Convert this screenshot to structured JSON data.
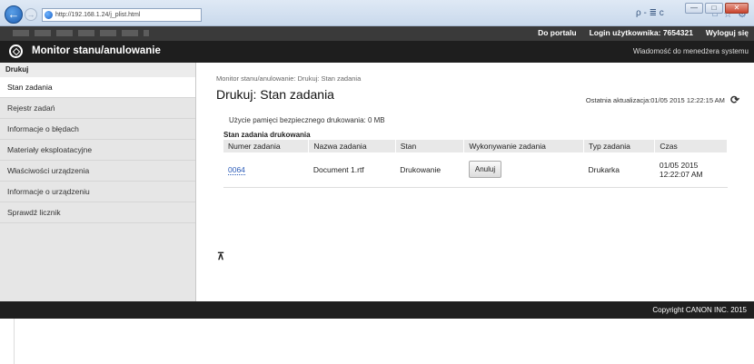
{
  "browser": {
    "url": "http://192.168.1.24/j_plist.html",
    "search_hint": "ρ - ≣ c",
    "icons": [
      "back-icon",
      "forward-icon",
      "home-icon",
      "star-icon",
      "gear-icon"
    ],
    "window_controls": [
      "—",
      "□",
      "✕"
    ]
  },
  "topbar": {
    "portal_link": "Do portalu",
    "login_label": "Login użytkownika:",
    "login_value": "7654321",
    "logout_link": "Wyloguj się"
  },
  "header": {
    "title": "Monitor stanu/anulowanie",
    "message_link": "Wiadomość do menedżera systemu"
  },
  "sidebar": {
    "heading": "Drukuj",
    "items": [
      {
        "label": "Stan zadania"
      },
      {
        "label": "Rejestr zadań"
      },
      {
        "label": "Informacje o błędach"
      },
      {
        "label": "Materiały eksploatacyjne"
      },
      {
        "label": "Właściwości urządzenia"
      },
      {
        "label": "Informacje o urządzeniu"
      },
      {
        "label": "Sprawdź licznik"
      }
    ]
  },
  "main": {
    "breadcrumb": "Monitor stanu/anulowanie: Drukuj: Stan zadania",
    "title": "Drukuj: Stan zadania",
    "last_update": "Ostatnia aktualizacja:01/05 2015 12:22:15 AM",
    "memory_usage": "Użycie pamięci bezpiecznego drukowania:   0 MB",
    "section_title": "Stan zadania drukowania",
    "table": {
      "headers": [
        "Numer zadania",
        "Nazwa zadania",
        "Stan",
        "Wykonywanie zadania",
        "Typ zadania",
        "Czas"
      ],
      "rows": [
        {
          "job_number": "0064",
          "job_name": "Document 1.rtf",
          "status": "Drukowanie",
          "action": "Anuluj",
          "job_type": "Drukarka",
          "time_line1": "01/05 2015",
          "time_line2": "12:22:07 AM"
        }
      ]
    },
    "to_top_glyph": "⊼"
  },
  "footer": {
    "copyright": "Copyright CANON INC. 2015"
  }
}
